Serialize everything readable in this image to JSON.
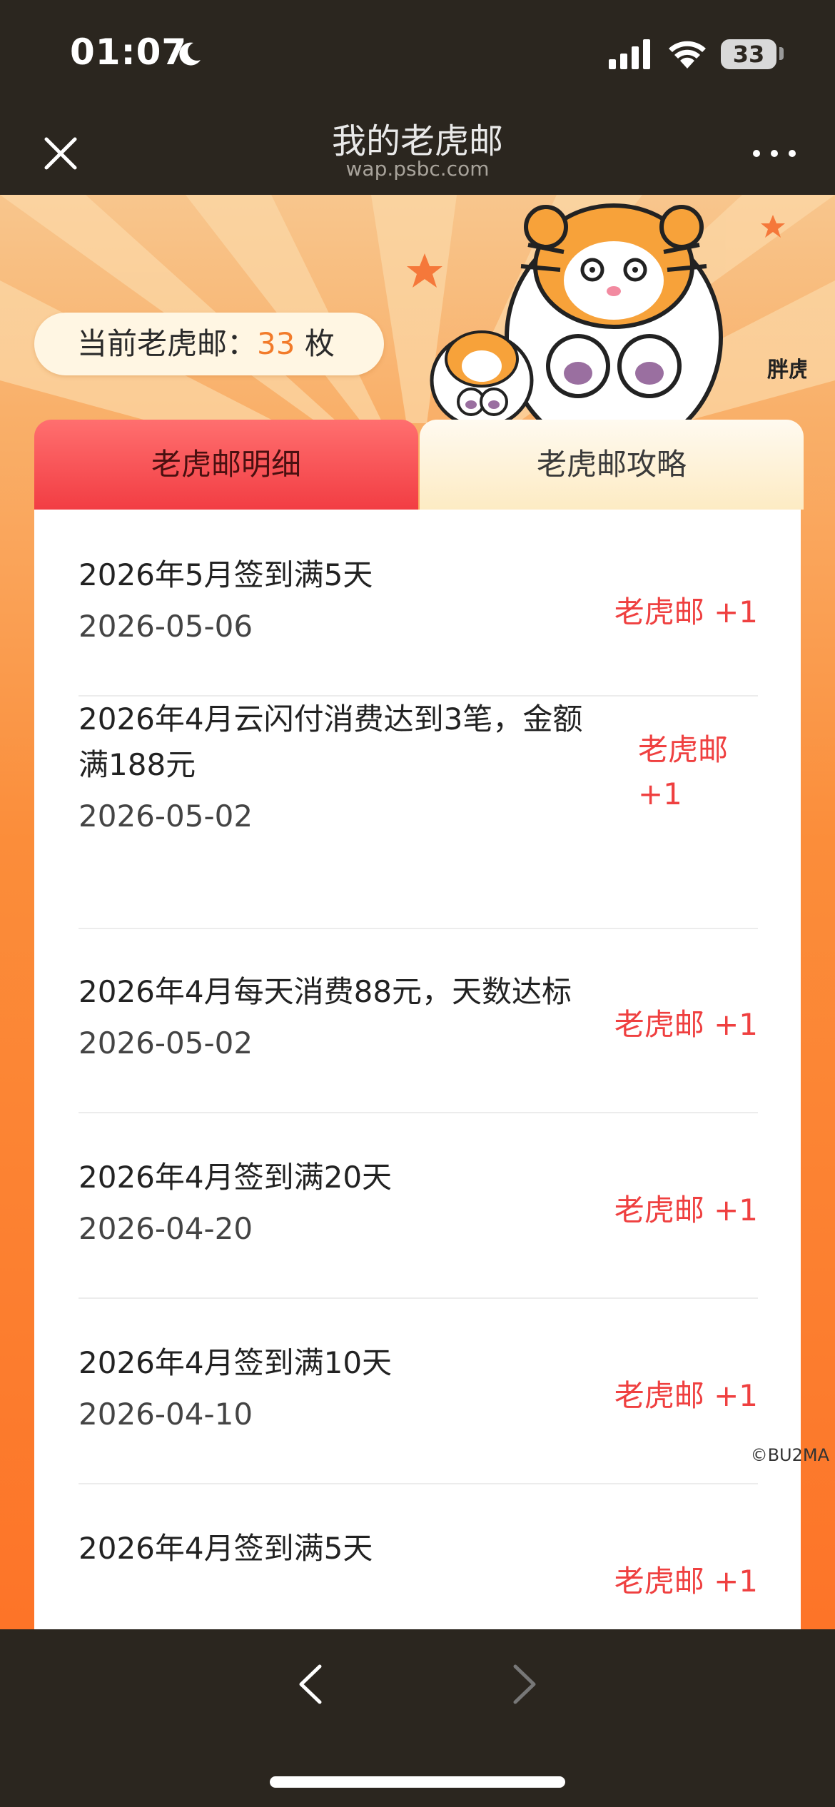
{
  "status_bar": {
    "time": "01:07",
    "battery": "33"
  },
  "nav": {
    "title": "我的老虎邮",
    "subtitle": "wap.psbc.com"
  },
  "summary": {
    "prefix": "当前老虎邮：",
    "count": "33",
    "unit": " 枚"
  },
  "tabs": [
    {
      "label": "老虎邮明细",
      "active": true
    },
    {
      "label": "老虎邮攻略",
      "active": false
    }
  ],
  "records": [
    {
      "title_line1": "2026年5月签到满5天",
      "title_line2": "",
      "date": "2026-05-06",
      "reward": "老虎邮 +1",
      "reward_line1": "",
      "reward_line2": ""
    },
    {
      "title_line1": "2026年4月云闪付消费达到3笔，金额",
      "title_line2": "满188元",
      "date": "2026-05-02",
      "reward": "",
      "reward_line1": "老虎邮",
      "reward_line2": "+1"
    },
    {
      "title_line1": "2026年4月每天消费88元，天数达标",
      "title_line2": "",
      "date": "2026-05-02",
      "reward": "老虎邮 +1",
      "reward_line1": "",
      "reward_line2": ""
    },
    {
      "title_line1": "2026年4月签到满20天",
      "title_line2": "",
      "date": "2026-04-20",
      "reward": "老虎邮 +1",
      "reward_line1": "",
      "reward_line2": ""
    },
    {
      "title_line1": "2026年4月签到满10天",
      "title_line2": "",
      "date": "2026-04-10",
      "reward": "老虎邮 +1",
      "reward_line1": "",
      "reward_line2": ""
    },
    {
      "title_line1": "2026年4月签到满5天",
      "title_line2": "",
      "date": "",
      "reward": "老虎邮 +1",
      "reward_line1": "",
      "reward_line2": ""
    }
  ],
  "watermark": "©BU2MA",
  "logo_text": "胖虎",
  "colors": {
    "accent_red": "#ef4040",
    "count_orange": "#f27b2a",
    "bar_dark": "#2b261f"
  },
  "icons": [
    "moon-icon",
    "signal-icon",
    "wifi-icon",
    "close-icon",
    "more-icon",
    "back-arrow-icon",
    "forward-arrow-icon"
  ]
}
